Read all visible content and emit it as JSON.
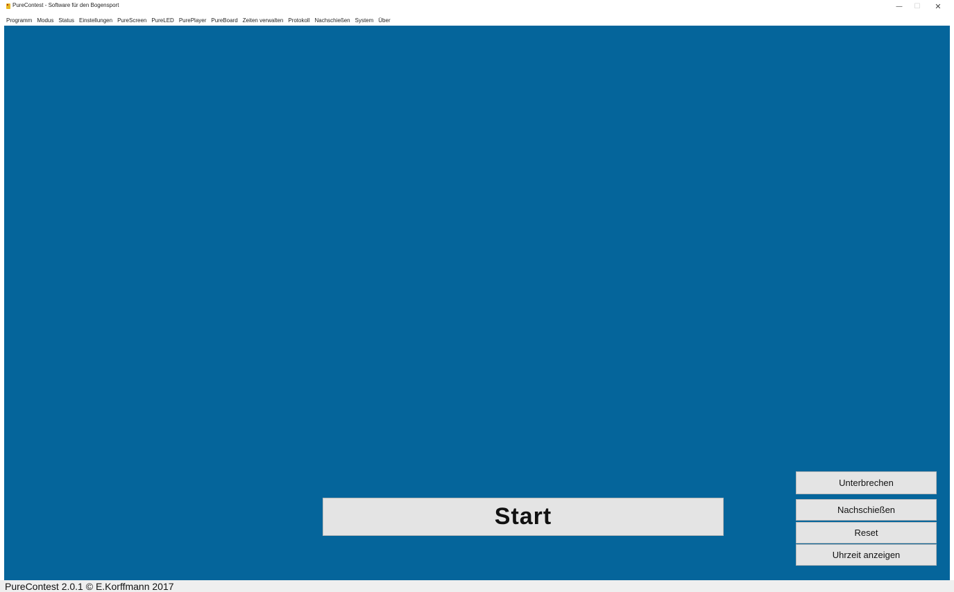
{
  "window": {
    "title": "PureContest - Software für den Bogensport",
    "controls": {
      "minimize": "—",
      "maximize": "☐",
      "close": "✕"
    }
  },
  "menu": {
    "items": [
      "Programm",
      "Modus",
      "Status",
      "Einstellungen",
      "PureScreen",
      "PureLED",
      "PurePlayer",
      "PureBoard",
      "Zeiten verwalten",
      "Protokoll",
      "Nachschießen",
      "System",
      "Über"
    ]
  },
  "main": {
    "background_color": "#05659b",
    "start_label": "Start",
    "side_buttons": {
      "interrupt_label": "Unterbrechen",
      "reshoot_label": "Nachschießen",
      "reset_label": "Reset",
      "show_time_label": "Uhrzeit anzeigen"
    }
  },
  "statusbar": {
    "text": "PureContest 2.0.1 © E.Korffmann 2017"
  }
}
